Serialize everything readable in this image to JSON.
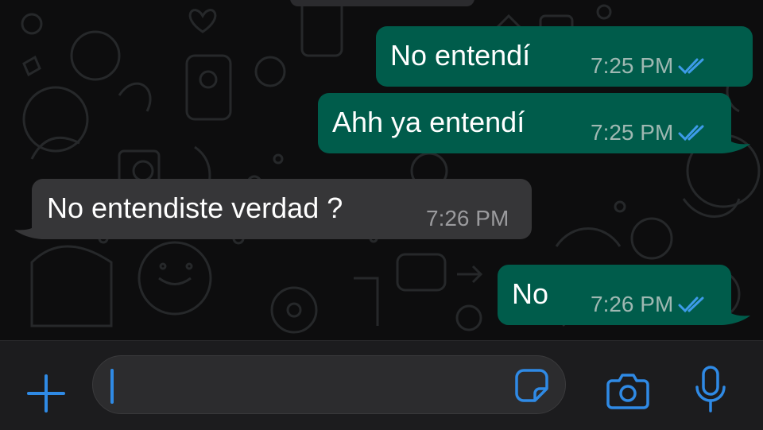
{
  "messages": [
    {
      "direction": "outgoing",
      "text": "No entendí",
      "time": "7:25 PM",
      "status": "read"
    },
    {
      "direction": "outgoing",
      "text": "Ahh ya entendí",
      "time": "7:25 PM",
      "status": "read"
    },
    {
      "direction": "incoming",
      "text": "No entendiste verdad ?",
      "time": "7:26 PM"
    },
    {
      "direction": "outgoing",
      "text": "No",
      "time": "7:26 PM",
      "status": "read"
    }
  ],
  "composer": {
    "input_value": "",
    "icons": [
      "plus-icon",
      "sticker-icon",
      "camera-icon",
      "microphone-icon"
    ]
  },
  "colors": {
    "outgoing_bubble": "#005c4b",
    "incoming_bubble": "#363638",
    "read_ticks": "#3d9be9",
    "accent": "#2f8ae5",
    "background": "#0d0d0e"
  }
}
